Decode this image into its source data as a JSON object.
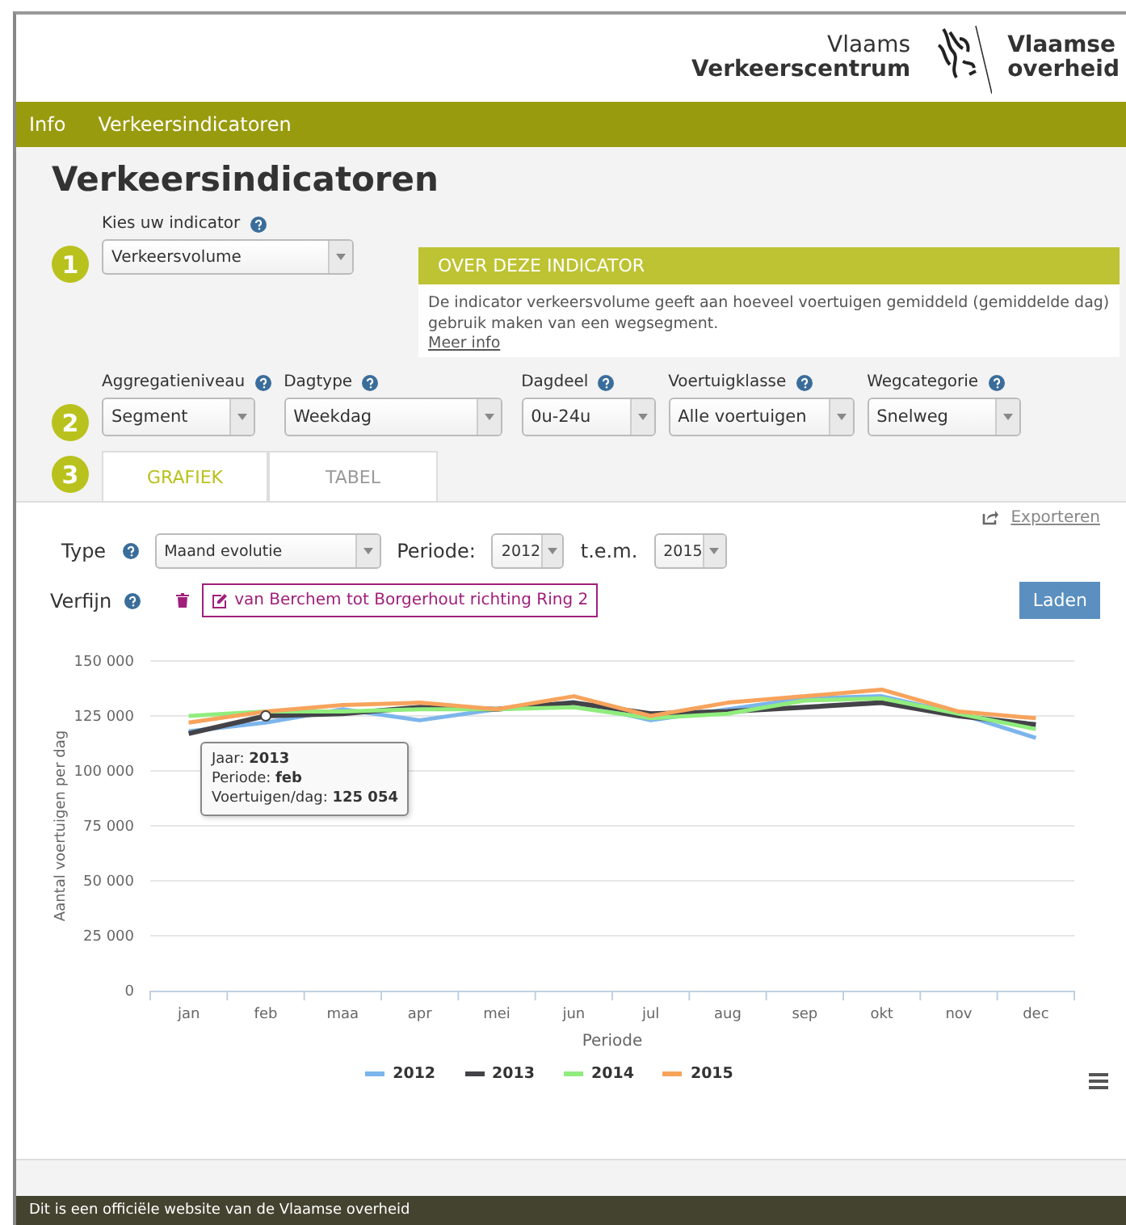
{
  "header": {
    "org_line1": "Vlaams",
    "org_line2": "Verkeerscentrum",
    "gov_line1": "Vlaamse",
    "gov_line2": "overheid"
  },
  "nav": [
    {
      "label": "Info"
    },
    {
      "label": "Verkeersindicatoren"
    }
  ],
  "title": "Verkeersindicatoren",
  "step1": {
    "number": "1",
    "label": "Kies uw indicator",
    "value": "Verkeersvolume"
  },
  "info_box": {
    "title": "OVER DEZE INDICATOR",
    "text": "De indicator verkeersvolume geeft aan hoeveel voertuigen gemiddeld (gemiddelde dag) gebruik maken van een wegsegment.",
    "link": "Meer info"
  },
  "step2": {
    "number": "2",
    "filters": [
      {
        "label": "Aggregatieniveau",
        "value": "Segment"
      },
      {
        "label": "Dagtype",
        "value": "Weekdag"
      },
      {
        "label": "Dagdeel",
        "value": "0u-24u"
      },
      {
        "label": "Voertuigklasse",
        "value": "Alle voertuigen"
      },
      {
        "label": "Wegcategorie",
        "value": "Snelweg"
      }
    ]
  },
  "step3": {
    "number": "3",
    "tabs": [
      {
        "label": "GRAFIEK",
        "selected": true
      },
      {
        "label": "TABEL",
        "selected": false
      }
    ]
  },
  "export_link": "Exporteren",
  "type_row": {
    "label": "Type",
    "value": "Maand evolutie",
    "period_label": "Periode:",
    "from": "2012",
    "to_label": "t.e.m.",
    "to": "2015"
  },
  "refine": {
    "label": "Verfijn",
    "chip": "van Berchem tot Borgerhout richting Ring 2",
    "button": "Laden"
  },
  "chart_data": {
    "type": "line",
    "xlabel": "Periode",
    "ylabel": "Aantal voertuigen per dag",
    "categories": [
      "jan",
      "feb",
      "maa",
      "apr",
      "mei",
      "jun",
      "jul",
      "aug",
      "sep",
      "okt",
      "nov",
      "dec"
    ],
    "ylim": [
      0,
      150000
    ],
    "grid": true,
    "yticks": [
      {
        "value": 0,
        "label": "0"
      },
      {
        "value": 25000,
        "label": "25 000"
      },
      {
        "value": 50000,
        "label": "50 000"
      },
      {
        "value": 75000,
        "label": "75 000"
      },
      {
        "value": 100000,
        "label": "100 000"
      },
      {
        "value": 125000,
        "label": "125 000"
      },
      {
        "value": 150000,
        "label": "150 000"
      }
    ],
    "series": [
      {
        "name": "2012",
        "color": "#7cb5ec",
        "values": [
          118000,
          122000,
          128000,
          123000,
          128000,
          131000,
          123000,
          128000,
          133000,
          134000,
          126000,
          115000
        ]
      },
      {
        "name": "2013",
        "color": "#434348",
        "values": [
          117000,
          125000,
          126000,
          129000,
          128000,
          131000,
          126000,
          127000,
          129000,
          131000,
          125000,
          121000
        ]
      },
      {
        "name": "2014",
        "color": "#90ed7d",
        "values": [
          125000,
          127000,
          127000,
          128000,
          128000,
          129000,
          124000,
          126000,
          132000,
          133000,
          126000,
          119000
        ]
      },
      {
        "name": "2015",
        "color": "#f7a35c",
        "values": [
          122000,
          127000,
          130000,
          131000,
          128000,
          134000,
          125000,
          131000,
          134000,
          137000,
          127000,
          124000
        ]
      }
    ]
  },
  "tooltip": {
    "lines": [
      "Jaar: **2013**",
      "Periode: **feb**",
      "Voertuigen/dag: **125 054**"
    ]
  },
  "footer": "Dit is een officiële website van de Vlaamse overheid"
}
